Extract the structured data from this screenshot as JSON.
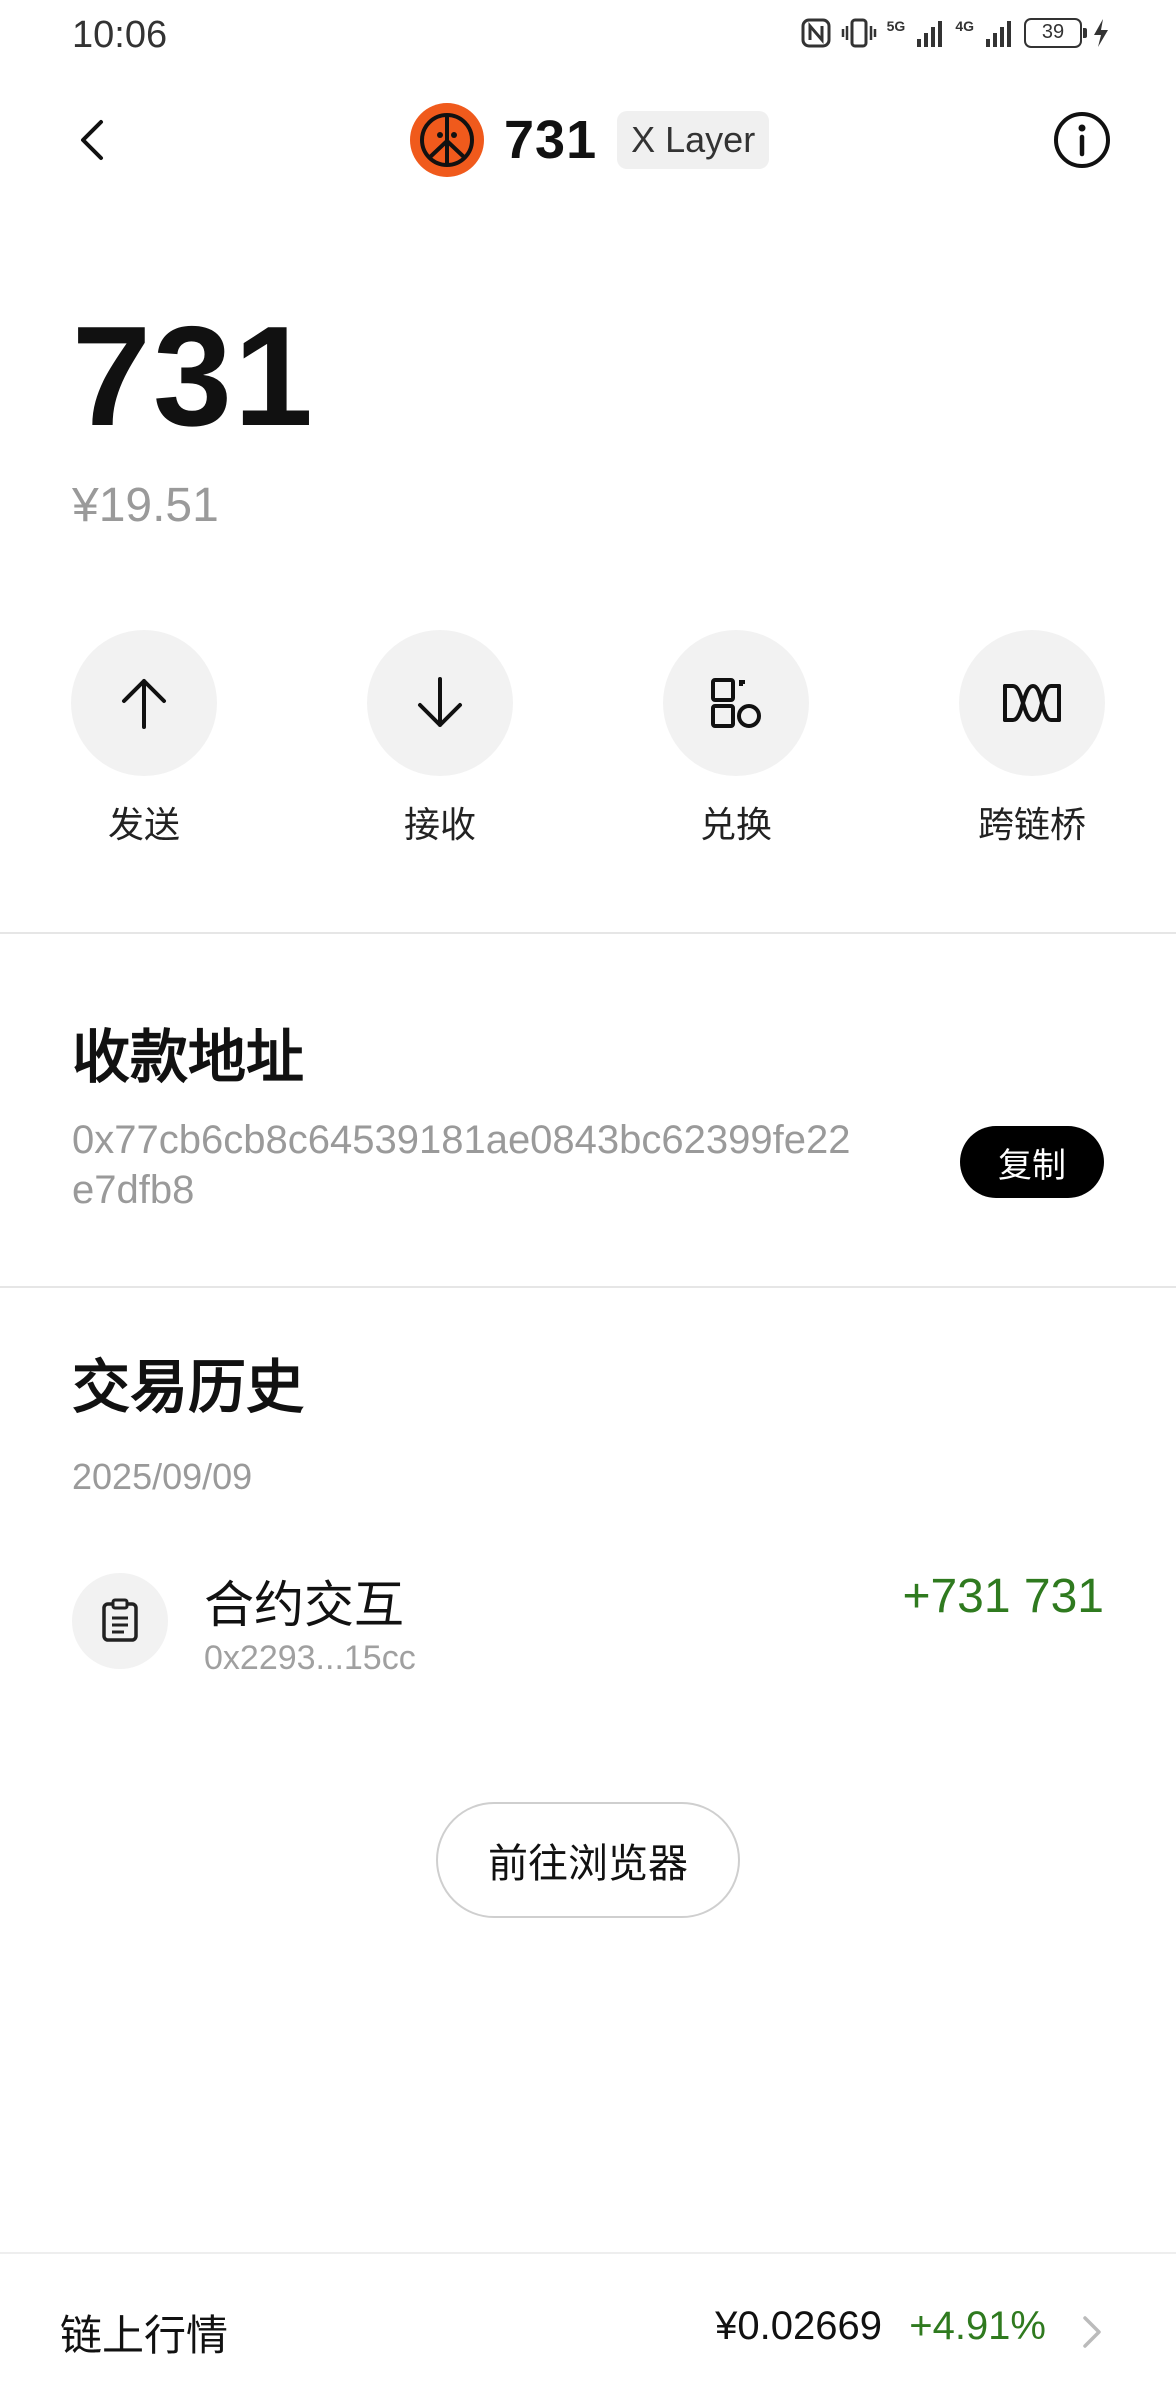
{
  "status_bar": {
    "time": "10:06",
    "battery_level": "39",
    "network_labels": [
      "5G",
      "4G"
    ]
  },
  "header": {
    "title": "731",
    "chain_badge": "X Layer",
    "logo_color": "#f05a1c"
  },
  "balance": {
    "amount": "731",
    "fiat": "¥19.51"
  },
  "actions": [
    {
      "label": "发送",
      "icon": "arrow-up-icon"
    },
    {
      "label": "接收",
      "icon": "arrow-down-icon"
    },
    {
      "label": "兑换",
      "icon": "swap-icon"
    },
    {
      "label": "跨链桥",
      "icon": "bridge-icon"
    }
  ],
  "address_section": {
    "title": "收款地址",
    "address": "0x77cb6cb8c64539181ae0843bc62399fe22e7dfb8",
    "copy_label": "复制"
  },
  "history": {
    "title": "交易历史",
    "date": "2025/09/09",
    "transactions": [
      {
        "title": "合约交互",
        "address": "0x2293...15cc",
        "amount": "+731 731",
        "icon": "clipboard-icon"
      }
    ],
    "explorer_label": "前往浏览器"
  },
  "market": {
    "label": "链上行情",
    "price": "¥0.02669",
    "change": "+4.91%",
    "change_color": "#2f7a1f"
  }
}
